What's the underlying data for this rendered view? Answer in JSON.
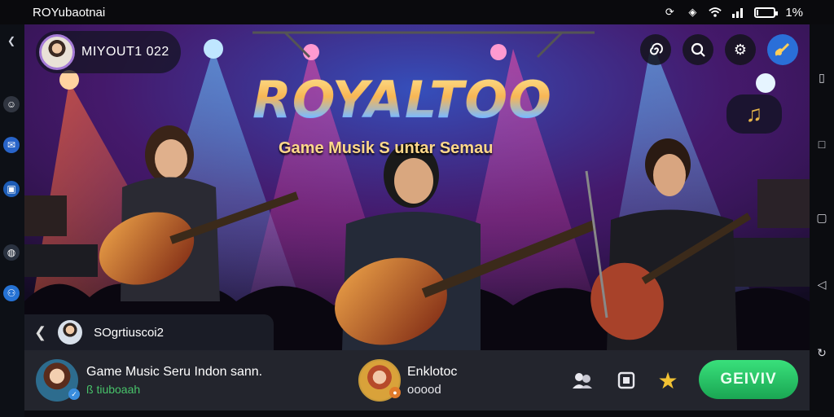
{
  "status_bar": {
    "app_title": "ROYubaotnai",
    "battery_text": "1%"
  },
  "profile": {
    "username": "MIYOUT1 022"
  },
  "hero": {
    "logo_text": "ROYALTOO",
    "tagline": "Game Musik S  untar Semau"
  },
  "overlay": {
    "username": "SOgrtiuscoi2"
  },
  "bottom_bar": {
    "track_title": "Game Music Seru Indon sann.",
    "track_sub": "ß tiuboaah",
    "artist_name": "Enklotoc",
    "artist_sub": "ooood",
    "get_label": "GEIVIV"
  },
  "colors": {
    "accent_green": "#1fb85c",
    "accent_blue": "#2a6fd8",
    "logo_gold": "#f6a52c"
  },
  "icons": {
    "top": [
      "spiral-icon",
      "search-icon",
      "gear-icon",
      "guitar-icon"
    ],
    "bottom": [
      "users-icon",
      "square-icon",
      "star-icon"
    ]
  }
}
